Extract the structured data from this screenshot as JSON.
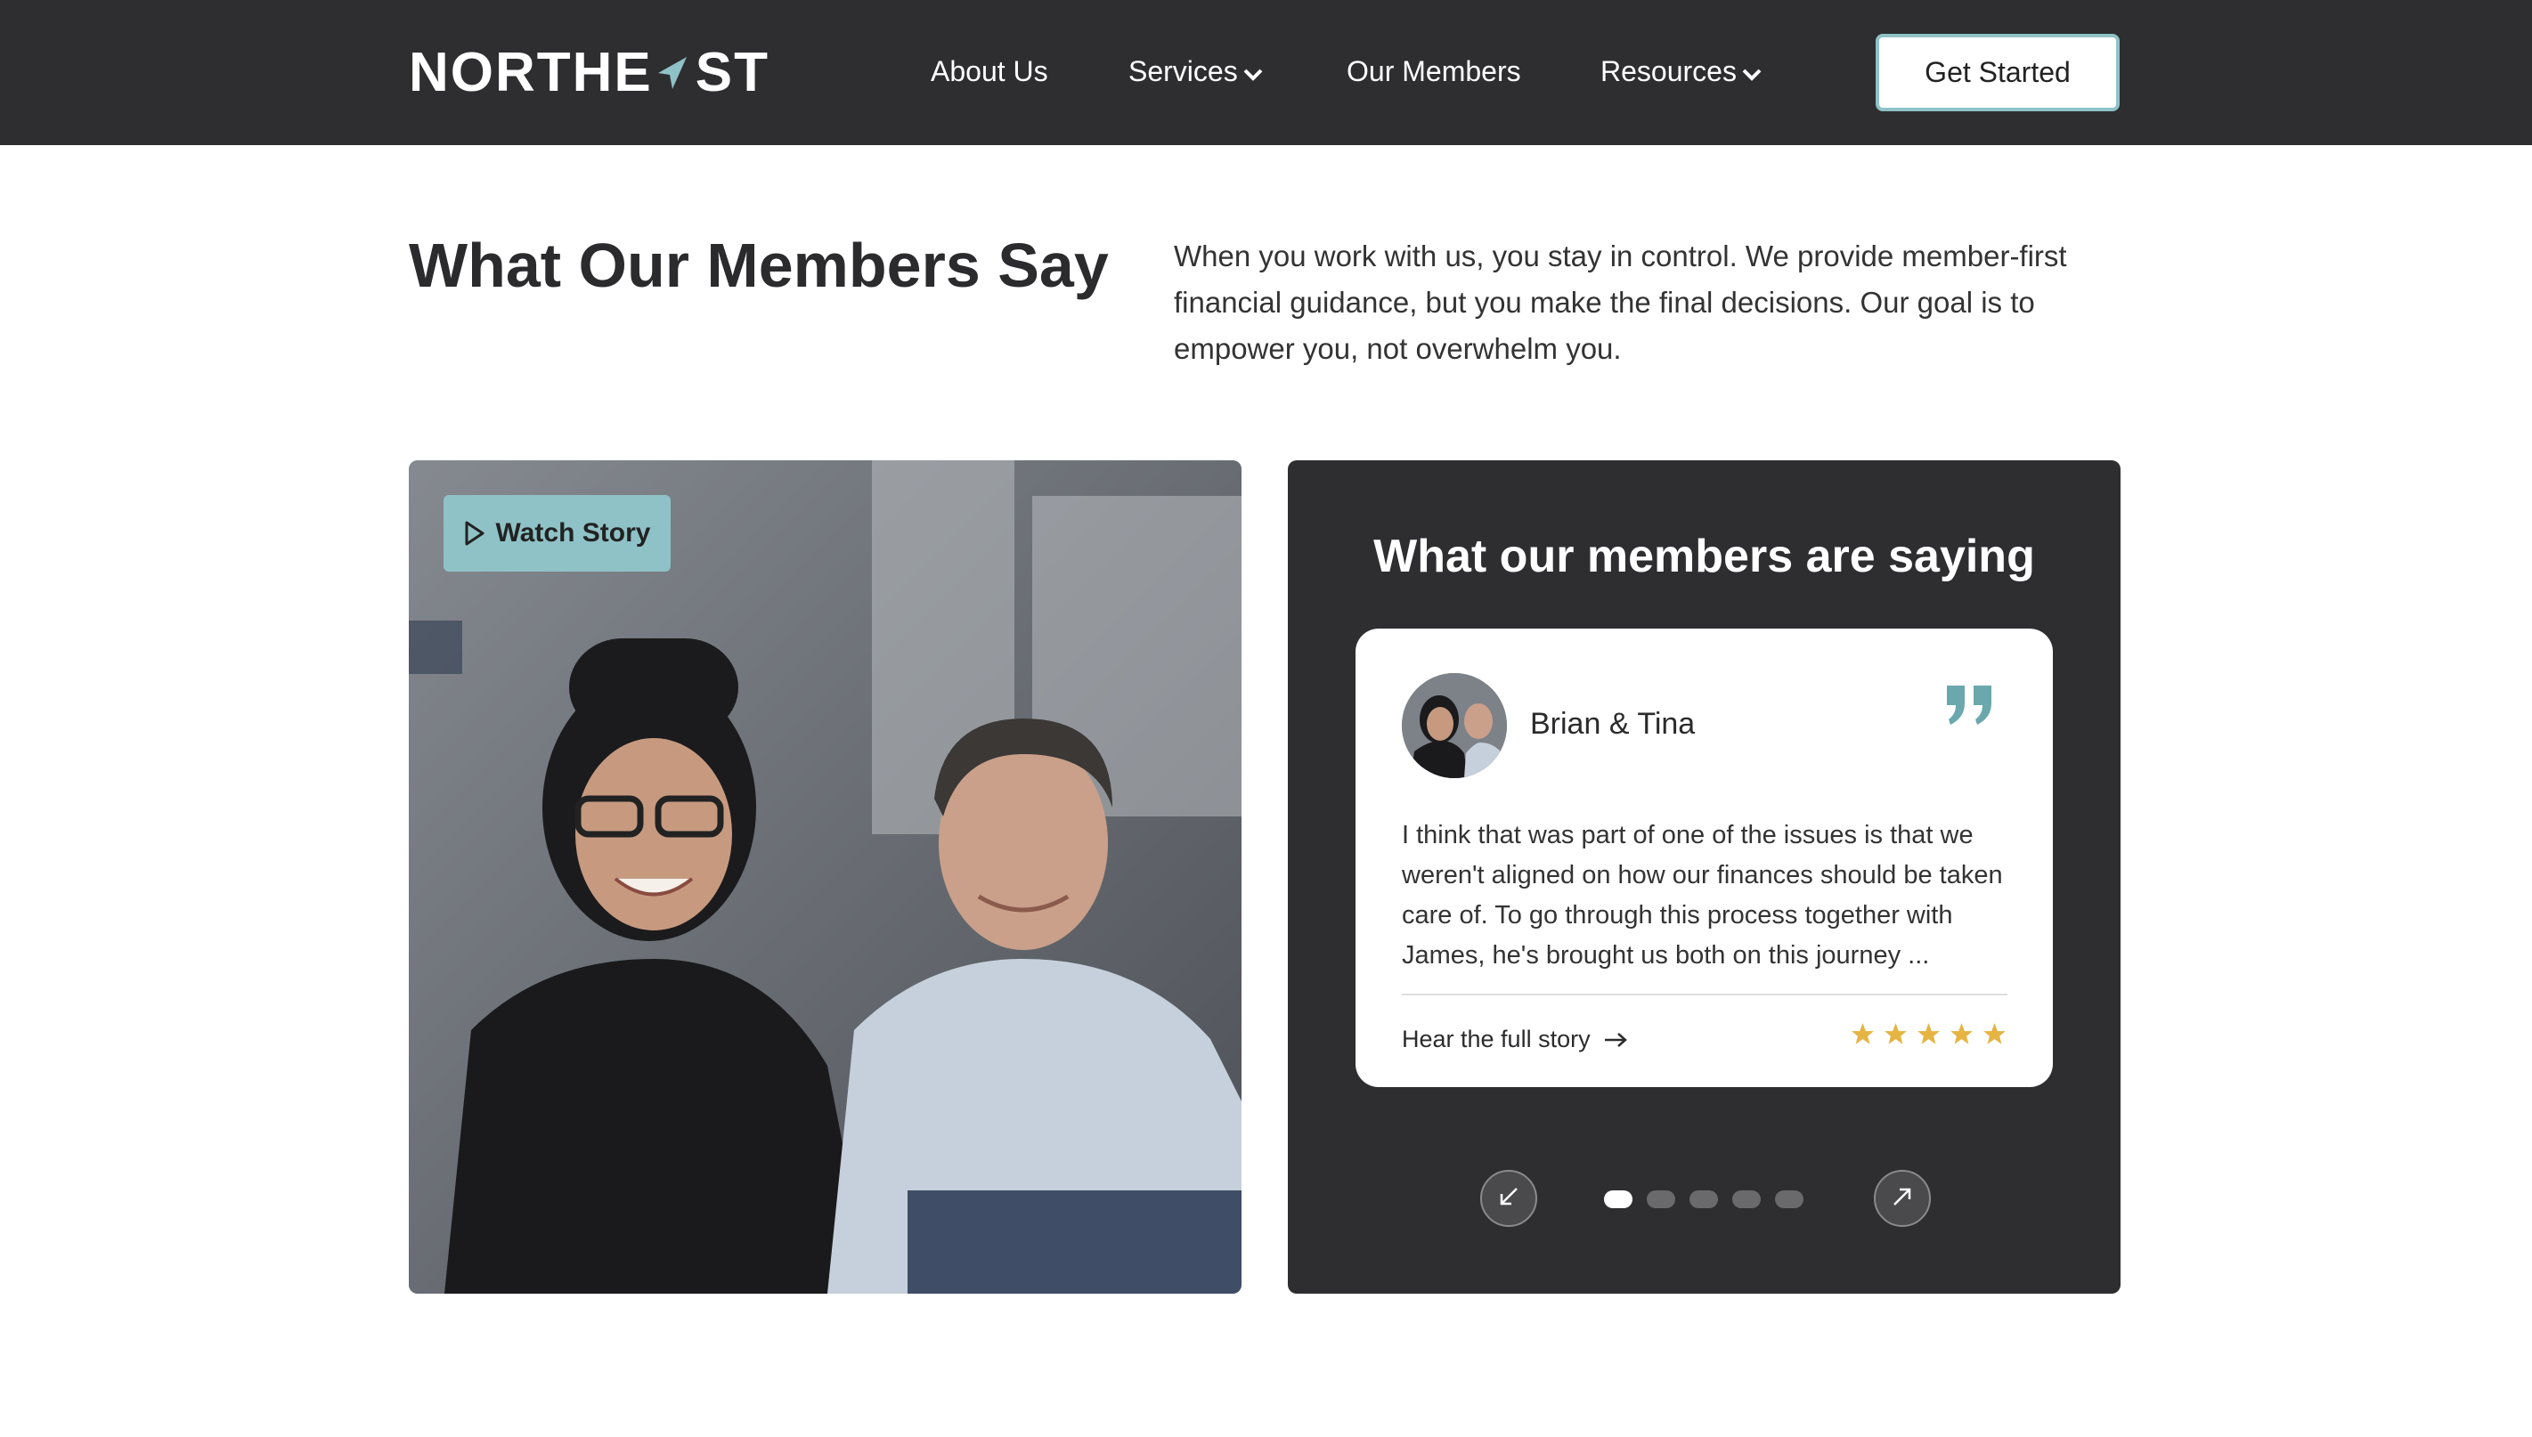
{
  "header": {
    "logo_text_left": "NORTHE",
    "logo_text_right": "ST",
    "nav": [
      {
        "label": "About Us"
      },
      {
        "label": "Services"
      },
      {
        "label": "Our Members"
      },
      {
        "label": "Resources"
      }
    ],
    "cta_label": "Get Started"
  },
  "intro": {
    "headline": "What Our Members Say",
    "text": "When you work with us, you stay in control. We provide member-first financial guidance, but you make the final decisions. Our goal is to empower you, not overwhelm you."
  },
  "video": {
    "watch_label": "Watch Story"
  },
  "testimonials": {
    "title": "What our members are saying",
    "name": "Brian & Tina",
    "quote": "I think that was part of one of the issues is that we weren't aligned on how our finances should be taken care of. To go through this process together with James, he's brought us both on this journey ...",
    "link_label": "Hear the full story",
    "rating": 5,
    "slide_count": 5,
    "active_slide": 1
  },
  "colors": {
    "header_bg": "#2e2e30",
    "accent": "#8fc2c6",
    "quote_accent": "#6aa8ad",
    "star": "#e5b443"
  },
  "icons": [
    "chevron-down-icon",
    "play-icon",
    "quote-icon",
    "arrow-right-icon",
    "star-icon",
    "arrow-down-left-icon",
    "arrow-up-right-icon"
  ]
}
